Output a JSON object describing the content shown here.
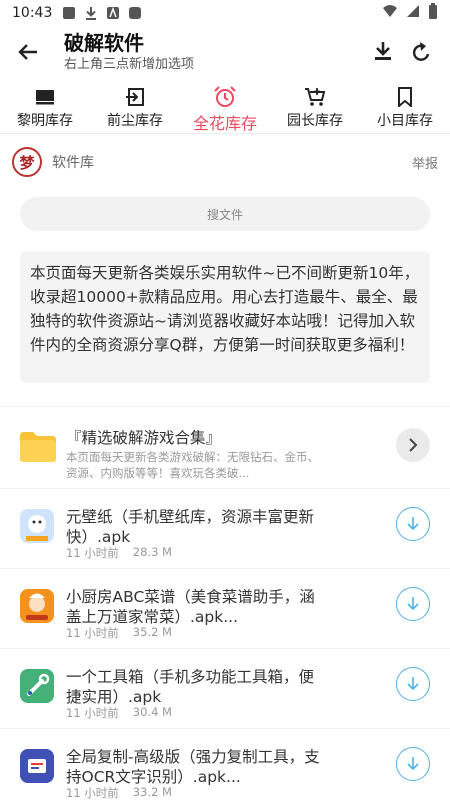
{
  "status_bar": {
    "time": "10:43"
  },
  "appbar": {
    "title": "破解软件",
    "subtitle": "右上角三点新增加选项"
  },
  "tabs": [
    {
      "label": "黎明库存",
      "icon": "keyboard-icon"
    },
    {
      "label": "前尘库存",
      "icon": "login-icon"
    },
    {
      "label": "全花库存",
      "icon": "alarm-icon",
      "active": true
    },
    {
      "label": "园长库存",
      "icon": "cart-icon"
    },
    {
      "label": "小目库存",
      "icon": "bookmark-icon"
    }
  ],
  "source": {
    "logo_text": "梦",
    "name": "软件库",
    "report": "举报"
  },
  "search": {
    "placeholder": "搜文件"
  },
  "notice": "本页面每天更新各类娱乐实用软件~已不间断更新10年，收录超10000+款精品应用。用心去打造最牛、最全、最独特的软件资源站~请浏览器收藏好本站哦！记得加入软件内的全商资源分享Q群，方便第一时间获取更多福利！",
  "collection": {
    "title": "『精选破解游戏合集』",
    "desc": "本页面每天更新各类游戏破解：无限钻石、金币、资源、内购版等等！喜欢玩各类破..."
  },
  "apps": [
    {
      "name": "元壁纸（手机壁纸库，资源丰富更新快）.apk",
      "time": "11 小时前",
      "size": "28.3 M"
    },
    {
      "name": "小厨房ABC菜谱（美食菜谱助手，涵盖上万道家常菜）.apk...",
      "time": "11 小时前",
      "size": "35.2 M"
    },
    {
      "name": "一个工具箱（手机多功能工具箱，便捷实用）.apk",
      "time": "11 小时前",
      "size": "30.4 M"
    },
    {
      "name": "全局复制-高级版（强力复制工具，支持OCR文字识别）.apk...",
      "time": "11 小时前",
      "size": "33.2 M"
    }
  ],
  "colors": {
    "accent": "#e84a5f",
    "download": "#4db3e6"
  }
}
